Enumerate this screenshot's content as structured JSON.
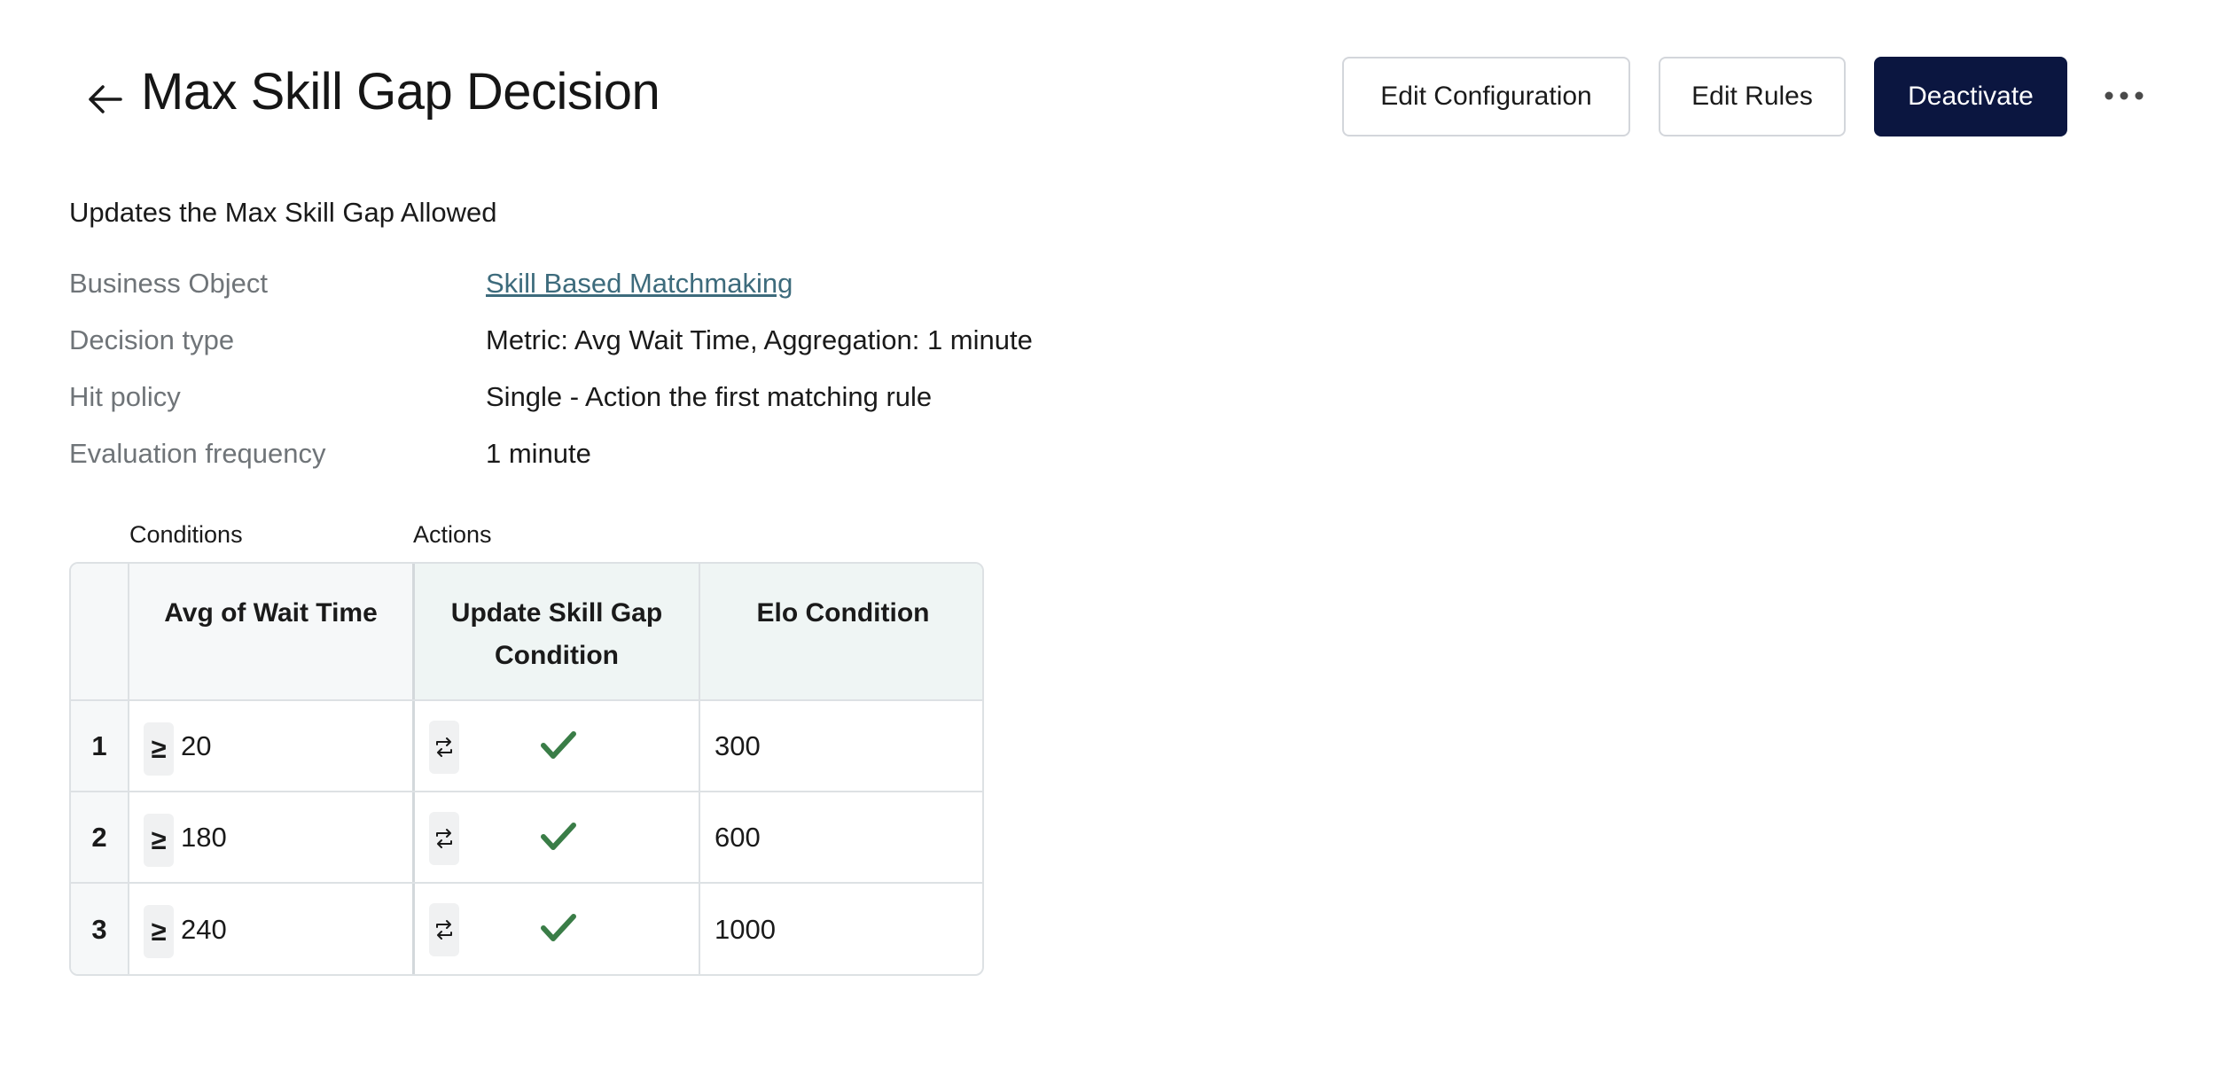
{
  "header": {
    "title": "Max Skill Gap Decision",
    "buttons": {
      "edit_configuration": "Edit Configuration",
      "edit_rules": "Edit Rules",
      "deactivate": "Deactivate"
    }
  },
  "description": "Updates the Max Skill Gap Allowed",
  "meta": {
    "business_object": {
      "label": "Business Object",
      "value": "Skill Based Matchmaking"
    },
    "decision_type": {
      "label": "Decision type",
      "value": "Metric: Avg Wait Time, Aggregation: 1 minute"
    },
    "hit_policy": {
      "label": "Hit policy",
      "value": "Single - Action the first matching rule"
    },
    "evaluation_frequency": {
      "label": "Evaluation frequency",
      "value": "1 minute"
    }
  },
  "table": {
    "section_conditions": "Conditions",
    "section_actions": "Actions",
    "columns": {
      "condition": "Avg of Wait Time",
      "update": "Update Skill Gap Condition",
      "elo": "Elo Condition"
    },
    "rows": [
      {
        "index": "1",
        "operator": "≥",
        "condition_value": "20",
        "update_enabled": true,
        "elo": "300"
      },
      {
        "index": "2",
        "operator": "≥",
        "condition_value": "180",
        "update_enabled": true,
        "elo": "600"
      },
      {
        "index": "3",
        "operator": "≥",
        "condition_value": "240",
        "update_enabled": true,
        "elo": "1000"
      }
    ]
  },
  "icons": {
    "back": "arrow-left-icon",
    "more": "more-horizontal-icon",
    "swap": "swap-arrows-icon",
    "check": "check-icon"
  },
  "colors": {
    "primary_button": "#0b1640",
    "link": "#3d6b7c",
    "check": "#3a7d47",
    "muted_label": "#6f7478"
  }
}
